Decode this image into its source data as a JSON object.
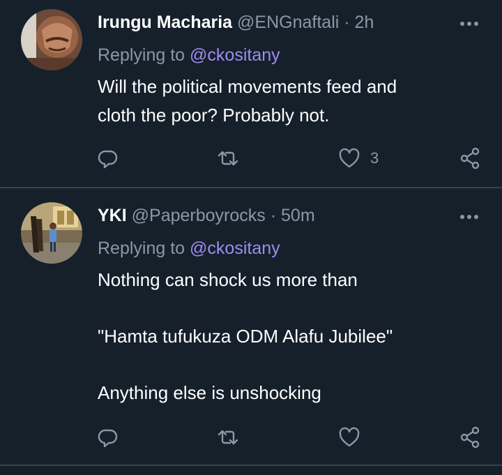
{
  "tweets": [
    {
      "name": "Irungu Macharia",
      "handle": "@ENGnaftali",
      "separator": "·",
      "time": "2h",
      "replying_prefix": "Replying to",
      "replying_to": "@ckositany",
      "lines": [
        "Will the political movements feed and",
        "cloth the poor? Probably not."
      ],
      "actions": {
        "reply_icon": "reply-icon",
        "retweet_icon": "retweet-icon",
        "like_icon": "heart-icon",
        "like_count": "3",
        "share_icon": "share-icon"
      }
    },
    {
      "name": "YKI",
      "handle": "@Paperboyrocks",
      "separator": "·",
      "time": "50m",
      "replying_prefix": "Replying to",
      "replying_to": "@ckositany",
      "paragraphs": [
        "Nothing can shock us more than",
        "\"Hamta tufukuza ODM Alafu Jubilee\"",
        "Anything else is unshocking"
      ],
      "actions": {
        "reply_icon": "reply-icon",
        "retweet_icon": "retweet-icon",
        "like_icon": "heart-icon",
        "like_count": "",
        "share_icon": "share-icon"
      }
    }
  ],
  "colors": {
    "background": "#15202b",
    "text": "#ffffff",
    "secondary": "#8899a6",
    "mention": "#a18bf2",
    "divider": "#38444d"
  }
}
